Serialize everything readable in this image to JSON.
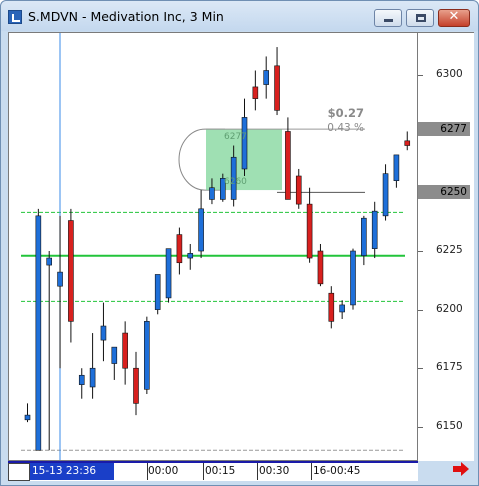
{
  "window": {
    "title": "S.MDVN - Medivation Inc, 3 Min",
    "close_glyph": "✕"
  },
  "price_axis": {
    "ticks": [
      "6300",
      "6277",
      "6250",
      "6225",
      "6200",
      "6175",
      "6150"
    ],
    "highlight_boxes": [
      "6277",
      "6250"
    ]
  },
  "time_axis": {
    "cursor_label": "15-13 23:36",
    "labels": [
      "00:00",
      "00:15",
      "00:30",
      "16-00:45"
    ]
  },
  "annotation": {
    "change": "$0.27",
    "percent": "0.43 %",
    "box_top_label": "6277",
    "box_bottom_label": "6260"
  },
  "colors": {
    "up_candle": "#1e6fd9",
    "down_candle": "#d8201e",
    "support_line": "#22c43a",
    "zone_fill": "#7fd69a",
    "cursor_line": "#3a8be8"
  },
  "chart_data": {
    "type": "candlestick",
    "title": "",
    "ylim": [
      6135,
      6318
    ],
    "yticks": [
      6150,
      6175,
      6200,
      6225,
      6250,
      6277,
      6300
    ],
    "candles": [
      {
        "o": 6153,
        "h": 6160,
        "l": 6152,
        "c": 6155
      },
      {
        "o": 6140,
        "h": 6243,
        "l": 6140,
        "c": 6240
      },
      {
        "o": 6219,
        "h": 6225,
        "l": 6140,
        "c": 6222
      },
      {
        "o": 6210,
        "h": 6240,
        "l": 6175,
        "c": 6216
      },
      {
        "o": 6238,
        "h": 6243,
        "l": 6186,
        "c": 6195
      },
      {
        "o": 6168,
        "h": 6175,
        "l": 6162,
        "c": 6172
      },
      {
        "o": 6167,
        "h": 6190,
        "l": 6162,
        "c": 6175
      },
      {
        "o": 6187,
        "h": 6203,
        "l": 6178,
        "c": 6193
      },
      {
        "o": 6177,
        "h": 6183,
        "l": 6170,
        "c": 6184
      },
      {
        "o": 6190,
        "h": 6195,
        "l": 6168,
        "c": 6175
      },
      {
        "o": 6175,
        "h": 6182,
        "l": 6155,
        "c": 6160
      },
      {
        "o": 6166,
        "h": 6197,
        "l": 6164,
        "c": 6195
      },
      {
        "o": 6200,
        "h": 6212,
        "l": 6198,
        "c": 6215
      },
      {
        "o": 6205,
        "h": 6226,
        "l": 6203,
        "c": 6226
      },
      {
        "o": 6232,
        "h": 6235,
        "l": 6215,
        "c": 6220
      },
      {
        "o": 6222,
        "h": 6228,
        "l": 6217,
        "c": 6224
      },
      {
        "o": 6225,
        "h": 6251,
        "l": 6222,
        "c": 6243
      },
      {
        "o": 6247,
        "h": 6256,
        "l": 6245,
        "c": 6252
      },
      {
        "o": 6247,
        "h": 6258,
        "l": 6246,
        "c": 6256
      },
      {
        "o": 6247,
        "h": 6270,
        "l": 6244,
        "c": 6265
      },
      {
        "o": 6260,
        "h": 6290,
        "l": 6257,
        "c": 6282
      },
      {
        "o": 6295,
        "h": 6302,
        "l": 6285,
        "c": 6290
      },
      {
        "o": 6296,
        "h": 6308,
        "l": 6290,
        "c": 6302
      },
      {
        "o": 6304,
        "h": 6312,
        "l": 6283,
        "c": 6285
      },
      {
        "o": 6276,
        "h": 6282,
        "l": 6250,
        "c": 6247
      },
      {
        "o": 6257,
        "h": 6260,
        "l": 6243,
        "c": 6245
      },
      {
        "o": 6245,
        "h": 6252,
        "l": 6220,
        "c": 6222
      },
      {
        "o": 6225,
        "h": 6228,
        "l": 6210,
        "c": 6211
      },
      {
        "o": 6207,
        "h": 6210,
        "l": 6192,
        "c": 6195
      },
      {
        "o": 6199,
        "h": 6204,
        "l": 6196,
        "c": 6202
      },
      {
        "o": 6202,
        "h": 6226,
        "l": 6200,
        "c": 6225
      },
      {
        "o": 6223,
        "h": 6240,
        "l": 6219,
        "c": 6239
      },
      {
        "o": 6226,
        "h": 6246,
        "l": 6222,
        "c": 6242
      },
      {
        "o": 6240,
        "h": 6262,
        "l": 6238,
        "c": 6258
      },
      {
        "o": 6255,
        "h": 6266,
        "l": 6252,
        "c": 6266
      },
      {
        "o": 6272,
        "h": 6276,
        "l": 6268,
        "c": 6270
      }
    ],
    "horizontal_lines": [
      {
        "price": 6241.5,
        "style": "dashed",
        "color": "#22c43a"
      },
      {
        "price": 6223,
        "style": "solid",
        "color": "#22c43a"
      },
      {
        "price": 6203.5,
        "style": "dashed",
        "color": "#22c43a"
      },
      {
        "price": 6250,
        "style": "solid",
        "color": "#555555"
      },
      {
        "price": 6277,
        "style": "solid",
        "color": "#999999"
      },
      {
        "price": 6140,
        "style": "dashed",
        "color": "#999999"
      }
    ],
    "zone": {
      "top": 6277,
      "bottom": 6251
    }
  }
}
